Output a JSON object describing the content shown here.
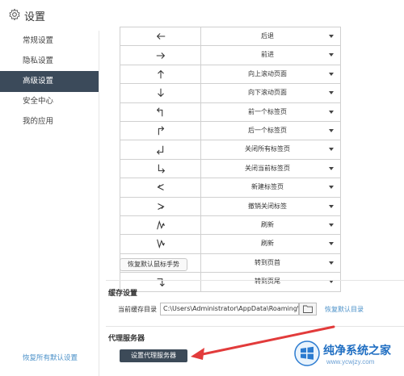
{
  "window": {
    "title": "设置",
    "icon": "gear-icon"
  },
  "sidebar": {
    "items": [
      {
        "label": "常规设置",
        "active": false
      },
      {
        "label": "隐私设置",
        "active": false
      },
      {
        "label": "高级设置",
        "active": true
      },
      {
        "label": "安全中心",
        "active": false
      },
      {
        "label": "我的应用",
        "active": false
      }
    ],
    "reset_all": "恢复所有默认设置"
  },
  "gestures": {
    "rows": [
      {
        "gesture": "arrow-left-icon",
        "action": "后退"
      },
      {
        "gesture": "arrow-right-icon",
        "action": "前进"
      },
      {
        "gesture": "arrow-up-icon",
        "action": "向上滚动页面"
      },
      {
        "gesture": "arrow-down-icon",
        "action": "向下滚动页面"
      },
      {
        "gesture": "up-left-gesture-icon",
        "action": "前一个标签页"
      },
      {
        "gesture": "up-right-gesture-icon",
        "action": "后一个标签页"
      },
      {
        "gesture": "down-left-gesture-icon",
        "action": "关闭所有标签页"
      },
      {
        "gesture": "down-right-gesture-icon",
        "action": "关闭当前标签页"
      },
      {
        "gesture": "zigzag-left-icon",
        "action": "新建标签页"
      },
      {
        "gesture": "zigzag-right-icon",
        "action": "撤销关闭标签"
      },
      {
        "gesture": "up-zigzag-icon",
        "action": "刷新"
      },
      {
        "gesture": "down-zigzag-icon",
        "action": "刷新"
      },
      {
        "gesture": "right-up-gesture-icon",
        "action": "转到页首"
      },
      {
        "gesture": "right-down-gesture-icon",
        "action": "转到页尾"
      }
    ],
    "restore_button": "恢复默认鼠标手势"
  },
  "cache": {
    "section_title": "缓存设置",
    "dir_label": "当前缓存目录",
    "dir_value": "C:\\Users\\Administrator\\AppData\\Roaming\\",
    "restore_link": "恢复默认目录"
  },
  "proxy": {
    "section_title": "代理服务器",
    "button_label": "设置代理服务器"
  },
  "watermark": {
    "title": "纯净系统之家",
    "url": "www.ycwjzy.com"
  },
  "colors": {
    "active_sidebar": "#3b4a5a",
    "link": "#4a90c8",
    "annotation_arrow": "#e23b3b"
  }
}
